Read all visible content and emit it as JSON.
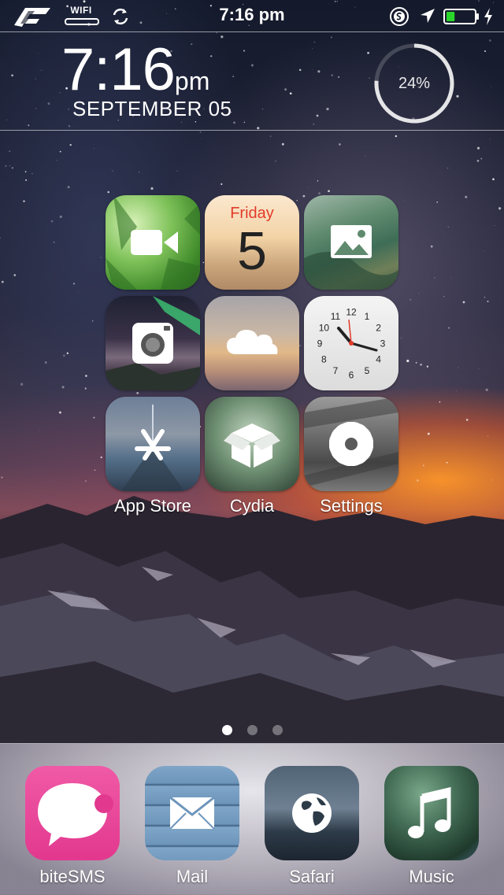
{
  "status_bar": {
    "network_label": "WIFI",
    "time": "7:16 pm",
    "battery_level": 0.3,
    "battery_color": "#2bd62b"
  },
  "widget": {
    "time": "7:16",
    "ampm": "pm",
    "date": "SEPTEMBER 05",
    "ring_percent_label": "24%",
    "ring_value": 0.76
  },
  "grid": {
    "calendar": {
      "day": "Friday",
      "date": "5"
    },
    "apps": [
      {
        "label": "App Store"
      },
      {
        "label": "Cydia"
      },
      {
        "label": "Settings"
      }
    ],
    "clock_numbers": [
      "12",
      "1",
      "2",
      "3",
      "4",
      "5",
      "6",
      "7",
      "8",
      "9",
      "10",
      "11"
    ]
  },
  "pages": {
    "count": 3,
    "current": 1
  },
  "dock": {
    "apps": [
      {
        "label": "biteSMS"
      },
      {
        "label": "Mail"
      },
      {
        "label": "Safari"
      },
      {
        "label": "Music"
      }
    ]
  },
  "colors": {
    "accent_red": "#e23b2b",
    "bitesms_pink": "#e2388e"
  }
}
